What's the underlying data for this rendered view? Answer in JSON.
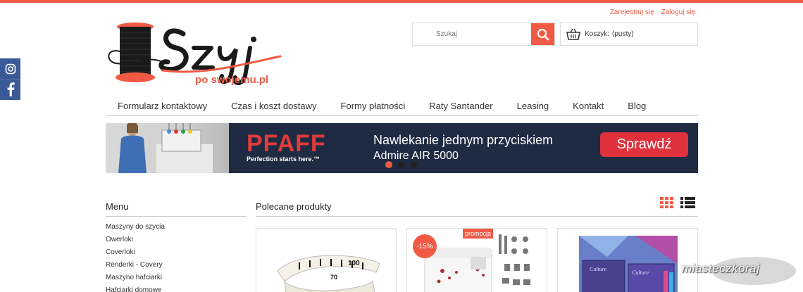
{
  "header": {
    "register_label": "Zarejestruj się",
    "login_label": "Zaloguj się",
    "logo_word": "Szyj",
    "logo_subtitle": "po swojemu.pl"
  },
  "search": {
    "placeholder": "Szukaj"
  },
  "cart": {
    "label": "Koszyk:",
    "status": "(pusty)"
  },
  "social": [
    "instagram-icon",
    "facebook-icon"
  ],
  "nav": {
    "items": [
      "Formularz kontaktowy",
      "Czas i koszt dostawy",
      "Formy płatności",
      "Raty Santander",
      "Leasing",
      "Kontakt",
      "Blog"
    ]
  },
  "banner": {
    "brand": "PFAFF",
    "brand_tagline": "Perfection starts here.™",
    "headline": "Nawlekanie jednym przyciskiem",
    "subheadline": "Admire AIR 5000",
    "button_label": "Sprawdź",
    "slides": 3,
    "active_slide": 1
  },
  "sidebar": {
    "title": "Menu",
    "items": [
      "Maszyny do szycia",
      "Owerloki",
      "Coverloki",
      "Renderki - Covery",
      "Maszyno hafciarki",
      "Hafciarki domowe"
    ]
  },
  "featured": {
    "title": "Polecane produkty",
    "products": [
      {
        "image": "measuring-tape",
        "discount": "",
        "promo": ""
      },
      {
        "image": "sewing-machine",
        "discount": "-15%",
        "promo": "promocja"
      },
      {
        "image": "sewing-kit-box",
        "discount": "",
        "promo": ""
      }
    ]
  },
  "watermark": "miasteczkoraj",
  "colors": {
    "accent": "#f05a45",
    "banner_bg": "#1f2b43",
    "facebook": "#3b5998"
  }
}
